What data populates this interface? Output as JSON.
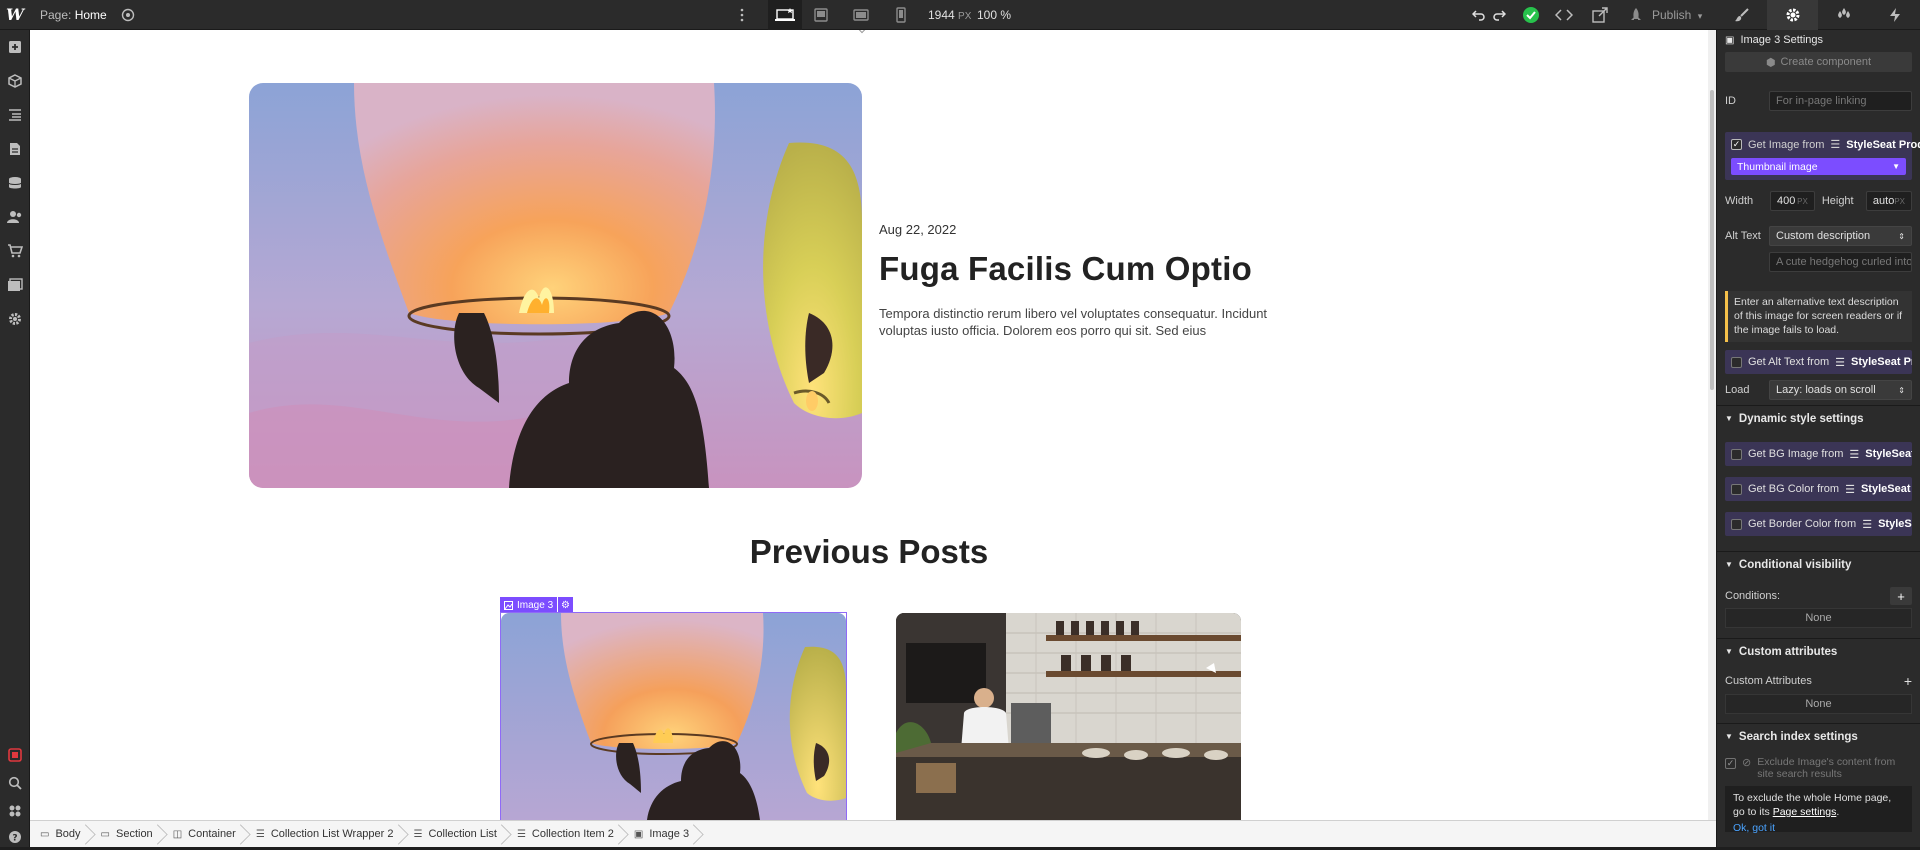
{
  "topbar": {
    "logo": "W",
    "page_prefix": "Page:",
    "page_name": "Home",
    "canvas_width": "1944",
    "canvas_unit": "PX",
    "zoom": "100 %",
    "publish_label": "Publish"
  },
  "left_toolbar": {
    "icons": [
      "add-icon",
      "components-icon",
      "navigator-icon",
      "pages-icon",
      "cms-icon",
      "users-icon",
      "ecommerce-icon",
      "assets-icon",
      "settings-icon"
    ],
    "bottom_icons": [
      "record-icon",
      "search-icon",
      "apps-icon",
      "help-icon"
    ]
  },
  "canvas": {
    "featured": {
      "date": "Aug 22, 2022",
      "title": "Fuga Facilis Cum Optio",
      "excerpt": "Tempora distinctio rerum libero vel voluptates consequatur. Incidunt voluptas iusto officia. Dolorem eos porro qui sit. Sed eius"
    },
    "previous_heading": "Previous Posts",
    "selection_tag": "Image 3"
  },
  "breadcrumbs": [
    {
      "label": "Body",
      "icon": "body-icon"
    },
    {
      "label": "Section",
      "icon": "section-icon"
    },
    {
      "label": "Container",
      "icon": "container-icon"
    },
    {
      "label": "Collection List Wrapper 2",
      "icon": "collection-wrapper-icon"
    },
    {
      "label": "Collection List",
      "icon": "collection-list-icon"
    },
    {
      "label": "Collection Item 2",
      "icon": "collection-item-icon"
    },
    {
      "label": "Image 3",
      "icon": "image-icon"
    }
  ],
  "panel": {
    "tabs": [
      "style-tab",
      "settings-tab",
      "interactions-tab",
      "lightning-tab"
    ],
    "header_title": "Image 3 Settings",
    "create_component": "Create component",
    "id_label": "ID",
    "id_placeholder": "For in-page linking",
    "get_image_label": "Get Image from",
    "get_image_source": "StyleSeat Prod...",
    "thumbnail_select": "Thumbnail image",
    "width_label": "Width",
    "width_value": "400",
    "width_unit": "PX",
    "height_label": "Height",
    "height_value": "auto",
    "height_unit": "PX",
    "alt_label": "Alt Text",
    "alt_select": "Custom description",
    "alt_placeholder": "A cute hedgehog curled into",
    "alt_note": "Enter an alternative text description of this image for screen readers or if the image fails to load.",
    "get_alt_label": "Get Alt Text from",
    "get_alt_source": "StyleSeat Pr...",
    "load_label": "Load",
    "load_select": "Lazy: loads on scroll",
    "dynamic_heading": "Dynamic style settings",
    "bg_image_label": "Get BG Image from",
    "bg_image_source": "StyleSeat ...",
    "bg_color_label": "Get BG Color from",
    "bg_color_source": "StyleSeat P...",
    "border_color_label": "Get Border Color from",
    "border_color_source": "StyleSe...",
    "visibility_heading": "Conditional visibility",
    "conditions_label": "Conditions:",
    "conditions_value": "None",
    "custom_attr_heading": "Custom attributes",
    "custom_attr_label": "Custom Attributes",
    "custom_attr_value": "None",
    "search_heading": "Search index settings",
    "exclude_label": "Exclude Image's content from site search results",
    "exclude_note_pre": "To exclude the whole Home page, go to its",
    "exclude_note_link": "Page settings",
    "exclude_note_post": ".",
    "ok_label": "Ok, got it"
  },
  "colors": {
    "accent": "#7c4dff",
    "binding_bg": "#3b3556",
    "published_ok": "#27c24c"
  }
}
